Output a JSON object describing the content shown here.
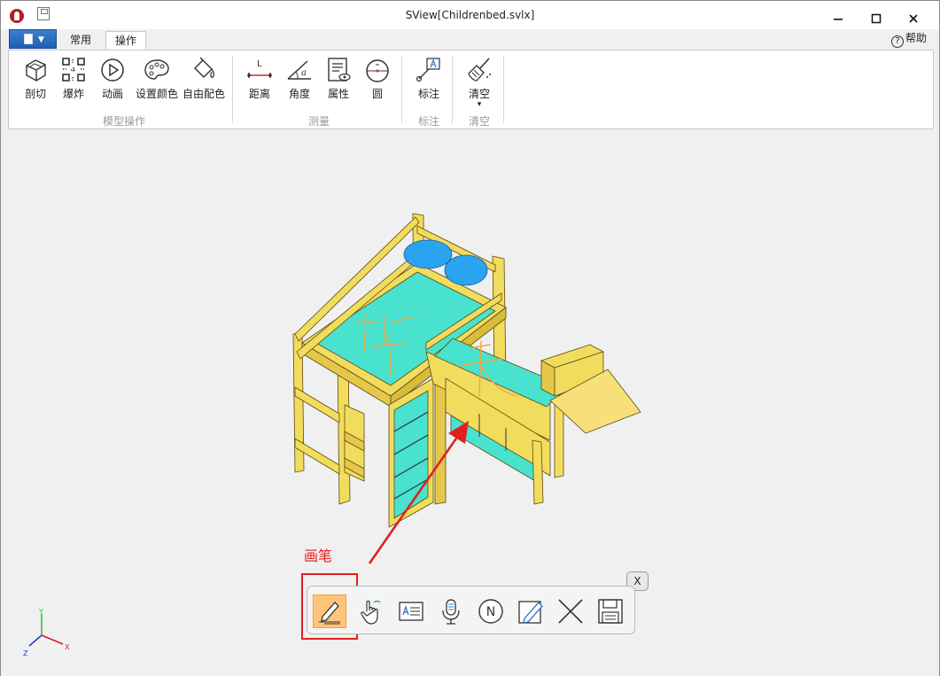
{
  "window": {
    "title": "SView[Childrenbed.svlx]",
    "minimize": "▬",
    "maximize": "▢",
    "close": "✕"
  },
  "tabs": {
    "common": "常用",
    "operations": "操作"
  },
  "help": {
    "icon": "?",
    "label": "帮助"
  },
  "ribbon": {
    "groups": {
      "model": "模型操作",
      "measure": "测量",
      "annotate": "标注",
      "clear": "清空"
    },
    "buttons": {
      "section": "剖切",
      "explode": "爆炸",
      "animation": "动画",
      "set_color": "设置颜色",
      "free_color": "自由配色",
      "distance": "距离",
      "angle": "角度",
      "property": "属性",
      "circle": "圆",
      "annotate": "标注",
      "clear": "清空"
    },
    "distance_glyph": "L",
    "angle_glyph": "a",
    "clear_caret": "▾"
  },
  "annotation": {
    "label": "画笔"
  },
  "float_toolbar": {
    "close_label": "X",
    "note_glyph": "N"
  },
  "axes": {
    "x": "X",
    "y": "Y",
    "z": "Z"
  },
  "colors": {
    "bed_wood": "#f2dc5d",
    "mattress": "#49e2cf",
    "pillow": "#2aa3f0",
    "annotation_red": "#e02020",
    "pen_stroke": "#f0a640",
    "active_tool": "#ffc47a"
  }
}
